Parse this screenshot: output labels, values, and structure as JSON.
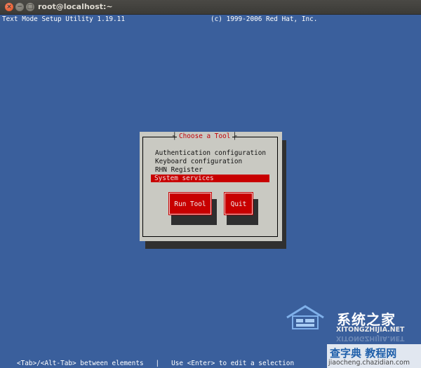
{
  "window": {
    "title": "root@localhost:~",
    "close_glyph": "×",
    "minimize_glyph": "−",
    "maximize_glyph": "□"
  },
  "header": {
    "left": "Text Mode Setup Utility 1.19.11",
    "right": "(c) 1999-2006 Red Hat, Inc."
  },
  "dialog": {
    "title": "Choose a Tool",
    "items": [
      {
        "label": "Authentication configuration"
      },
      {
        "label": "Keyboard configuration"
      },
      {
        "label": "RHN Register"
      },
      {
        "label": "System services"
      }
    ],
    "selected_index": 3,
    "buttons": {
      "run": "Run Tool",
      "quit": "Quit"
    }
  },
  "footer": {
    "hint": "<Tab>/<Alt-Tab> between elements   |   Use <Enter> to edit a selection"
  },
  "watermark": {
    "brand_cn": "系统之家",
    "brand_en": "XITONGZHIJIA.NET",
    "site2_cn": "查字典 教程网",
    "site2_url": "jiaocheng.chazidian.com"
  },
  "colors": {
    "background": "#3a5f9c",
    "dialog": "#c9c9c2",
    "accent": "#c80000"
  }
}
